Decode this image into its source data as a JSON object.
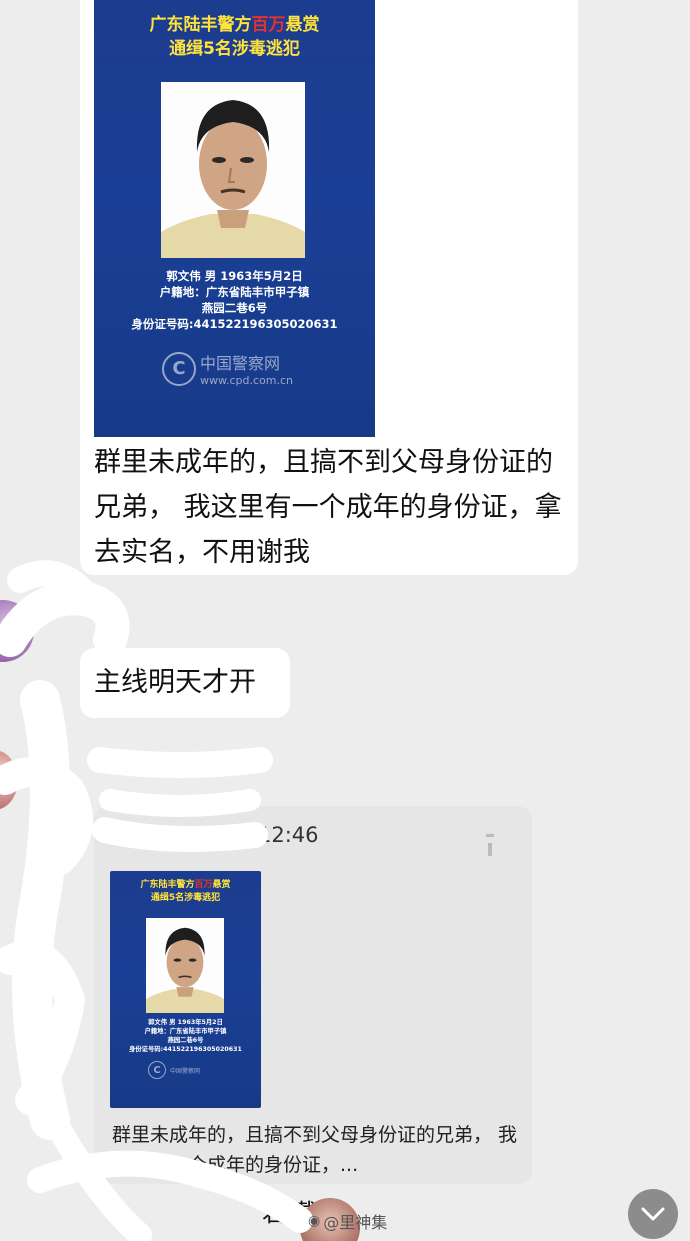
{
  "messages": [
    {
      "poster": {
        "title_prefix": "广东陆丰警方",
        "title_highlight": "百万",
        "title_suffix": "悬赏",
        "title_line2": "通缉5名涉毒逃犯",
        "info_line1": "郭文伟 男 1963年5月2日",
        "info_line2": "户籍地：广东省陆丰市甲子镇",
        "info_line3": "燕园二巷6号",
        "info_line4": "身份证号码:441522196305020631",
        "logo_cn": "中国警察网",
        "logo_url": "www.cpd.com.cn"
      },
      "text": "群里未成年的，且搞不到父母身份证的兄弟， 我这里有一个成年的身份证，拿去实名，不用谢我"
    },
    {
      "text": "主线明天才开"
    },
    {
      "forwarded": {
        "time": "12:46",
        "poster": {
          "title_prefix": "广东陆丰警方",
          "title_highlight": "百万",
          "title_suffix": "悬赏",
          "title_line2": "通缉5名涉毒逃犯",
          "info_line1": "郭文伟 男 1963年5月2日",
          "info_line2": "户籍地：广东省陆丰市甲子镇",
          "info_line3": "燕园二巷6号",
          "info_line4": "身份证号码:441522196305020631",
          "logo_cn": "中国警察网",
          "logo_url": "www.cpd.com.cn"
        },
        "text": "群里未成年的，且搞不到父母身份证的兄弟， 我这里有一个成年的身份证，..."
      }
    }
  ],
  "bottom_name": "君    戴德",
  "watermark": "@里神集",
  "icons": {
    "scroll_down": "chevron-down-icon",
    "pin": "pin-icon",
    "weibo": "weibo-icon"
  },
  "colors": {
    "poster_blue": "#1a3f96",
    "title_yellow": "#ffe33a",
    "title_red": "#e6322d",
    "chat_bg": "#ededed"
  }
}
